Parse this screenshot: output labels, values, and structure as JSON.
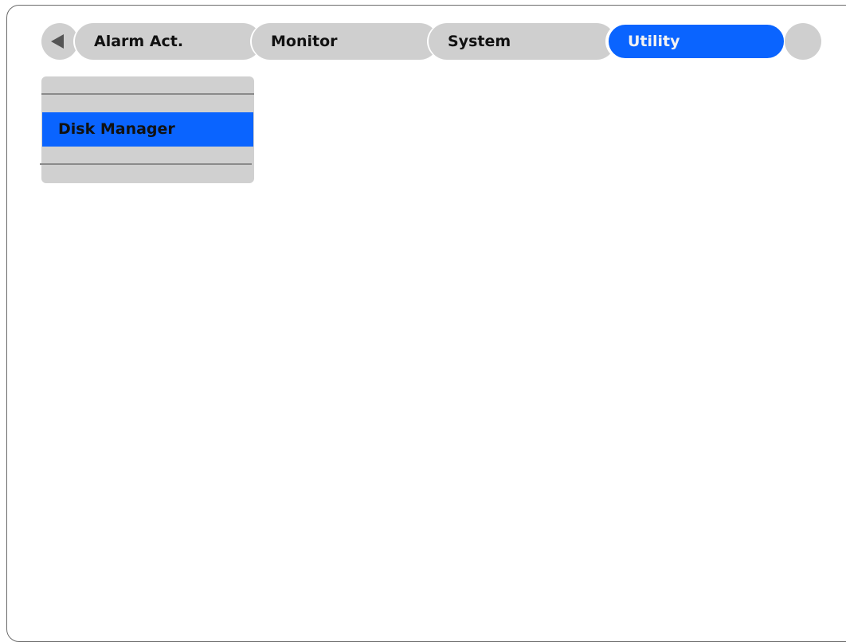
{
  "colors": {
    "selected_blue": "#0a64ff",
    "tab_gray": "#cfcfcf",
    "panel_gray": "#d0d0d0"
  },
  "nav": {
    "prev_icon": "triangle-left-icon",
    "next_icon": "blank-circle"
  },
  "tabs": [
    {
      "label": "Alarm Act.",
      "selected": false
    },
    {
      "label": "Monitor",
      "selected": false
    },
    {
      "label": "System",
      "selected": false
    },
    {
      "label": "Utility",
      "selected": true
    }
  ],
  "submenu": {
    "items": [
      {
        "label": "Disk Manager",
        "selected": true
      }
    ]
  }
}
